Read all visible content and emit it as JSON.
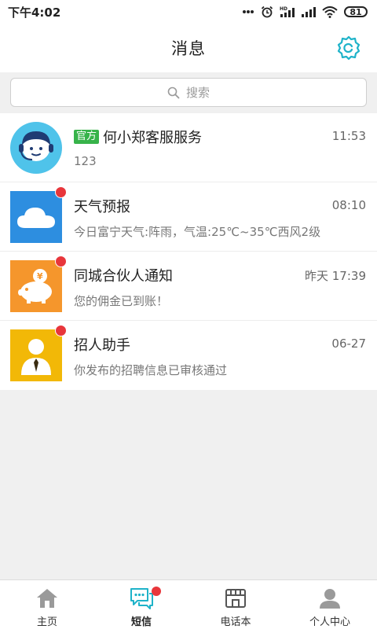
{
  "status_bar": {
    "time": "下午4:02",
    "battery": "81",
    "icons": [
      "more-dots-icon",
      "alarm-icon",
      "hd-signal-icon",
      "signal-icon",
      "wifi-icon",
      "battery-icon"
    ]
  },
  "header": {
    "title": "消息",
    "settings_icon": "settings-icon"
  },
  "search": {
    "placeholder": "搜索",
    "icon": "search-icon"
  },
  "messages": [
    {
      "tag": "官方",
      "name": "何小郑客服服务",
      "time": "11:53",
      "preview": "123",
      "avatar_icon": "customer-service-icon",
      "unread": false
    },
    {
      "name": "天气预报",
      "time": "08:10",
      "preview": "今日富宁天气:阵雨，气温:25℃~35℃西风2级",
      "avatar_icon": "cloud-icon",
      "unread": true
    },
    {
      "name": "同城合伙人通知",
      "time": "昨天 17:39",
      "preview": "您的佣金已到账！",
      "avatar_icon": "piggy-bank-icon",
      "unread": true
    },
    {
      "name": "招人助手",
      "time": "06-27",
      "preview": "你发布的招聘信息已审核通过",
      "avatar_icon": "recruiter-icon",
      "unread": true
    }
  ],
  "tabs": [
    {
      "label": "主页",
      "icon": "home-icon",
      "active": false
    },
    {
      "label": "短信",
      "icon": "chat-icon",
      "active": true,
      "badge": true
    },
    {
      "label": "电话本",
      "icon": "shop-icon",
      "active": false
    },
    {
      "label": "个人中心",
      "icon": "person-icon",
      "active": false
    }
  ],
  "colors": {
    "accent": "#1fb3c9",
    "unread_dot": "#e8363b",
    "official_tag": "#37b34a",
    "weather_bg": "#2d8ee0",
    "partner_bg": "#f5962c",
    "recruiter_bg": "#f2b807"
  }
}
